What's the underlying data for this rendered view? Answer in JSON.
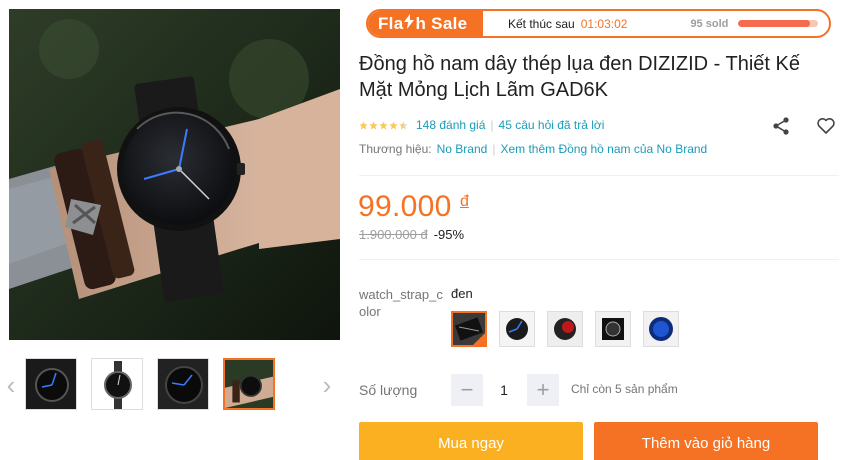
{
  "gallery": {
    "thumbnails": [
      "watch-front",
      "watch-mesh",
      "watch-dial",
      "watch-wrist"
    ],
    "active_thumbnail": 3
  },
  "flash_sale": {
    "brand_pre": "Fla",
    "brand_post": "h Sale",
    "ends_label": "Kết thúc sau",
    "timer": "01:03:02",
    "sold": "95 sold",
    "sold_progress": 0.9
  },
  "product": {
    "title": "Đồng hồ nam dây thép lụa đen DIZIZID - Thiết Kế Mặt Mỏng Lịch Lãm GAD6K",
    "rating": 4.5,
    "ratings_count": "148 đánh giá",
    "questions": "45 câu hỏi đã trả lời",
    "brand_label": "Thương hiệu:",
    "brand": "No Brand",
    "more_link": "Xem thêm Đồng hồ nam của No Brand"
  },
  "price": {
    "current": "99.000",
    "currency": "đ",
    "original": "1.900.000 đ",
    "discount": "-95%"
  },
  "variant": {
    "label": "watch_strap_color",
    "selected": "đen",
    "swatches": [
      "black-mesh",
      "blue-hands",
      "red-dial",
      "black-box",
      "blue-dial"
    ],
    "active": 0
  },
  "quantity": {
    "label": "Số lượng",
    "minus": "−",
    "plus": "+",
    "value": "1",
    "stock": "Chỉ còn 5 sản phẩm"
  },
  "actions": {
    "buy_now": "Mua ngay",
    "add_to_cart": "Thêm vào giỏ hàng"
  },
  "colors": {
    "accent": "#f57224",
    "buy": "#fbb022",
    "link": "#1a9cb7"
  }
}
